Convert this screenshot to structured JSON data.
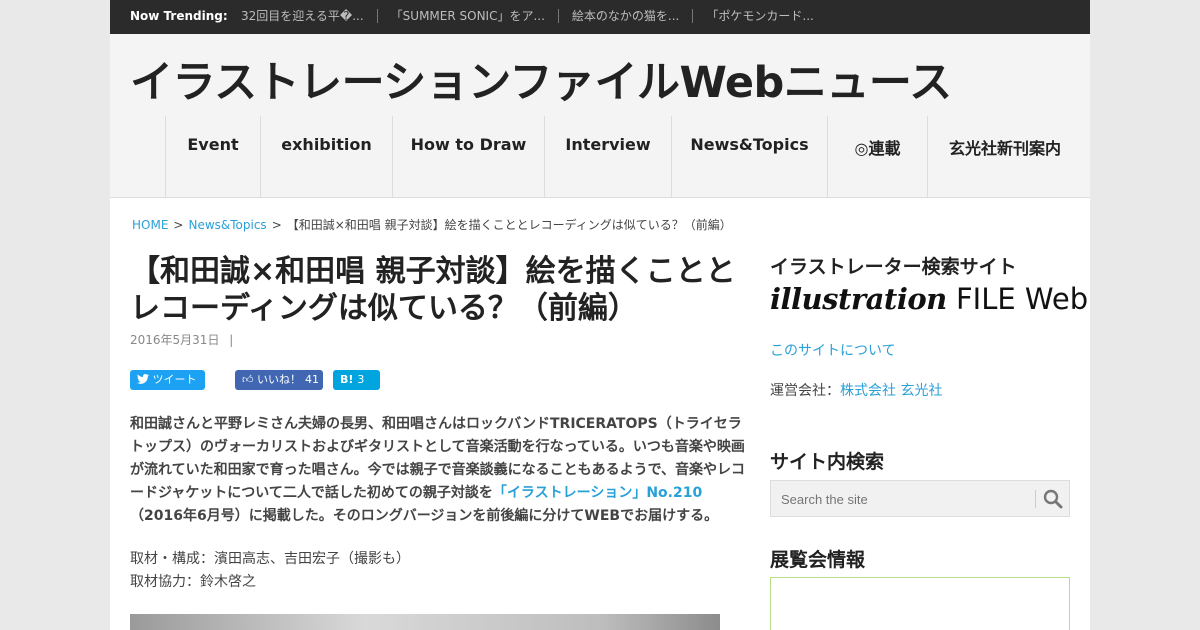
{
  "trending": {
    "label": "Now Trending:",
    "items": [
      "32回目を迎える平�...",
      "「SUMMER SONIC」をア...",
      "絵本のなかの猫を...",
      "「ポケモンカード..."
    ]
  },
  "site": {
    "title": "イラストレーションファイルWebニュース"
  },
  "nav": [
    "Event",
    "exhibition",
    "How to Draw",
    "Interview",
    "News&Topics",
    "◎連載",
    "玄光社新刊案内"
  ],
  "breadcrumb": {
    "home": "HOME",
    "sep": ">",
    "category": "News&Topics",
    "current": "【和田誠×和田唱 親子対談】絵を描くこととレコーディングは似ている？（前編）"
  },
  "post": {
    "title": "【和田誠×和田唱 親子対談】絵を描くこととレコーディングは似ている？（前編）",
    "date": "2016年5月31日",
    "meta_sep": "|",
    "share": {
      "tweet": "ツイート",
      "like": "いいね！",
      "like_count": "41",
      "hatena": "B!",
      "hatena_count": "3"
    },
    "lead_before": "和田誠さんと平野レミさん夫婦の長男、和田唱さんはロックバンドTRICERATOPS（トライセラトップス）のヴォーカリストおよびギタリストとして音楽活動を行なっている。いつも音楽や映画が流れていた和田家で育った唱さん。今では親子で音楽談義になることもあるようで、音楽やレコードジャケットについて二人で話した初めての親子対談を",
    "lead_link": "「イラストレーション」No.210",
    "lead_after": "（2016年6月号）に掲載した。そのロングバージョンを前後編に分けてWEBでお届けする。",
    "credit1": "取材・構成：濱田高志、吉田宏子（撮影も）",
    "credit2": "取材協力：鈴木啓之"
  },
  "sidebar": {
    "search_site_heading": "イラストレーター検索サイト",
    "logo_script": "illustration",
    "logo_text": "FILE Web",
    "about_link": "このサイトについて",
    "company_label": "運営会社：",
    "company_link": "株式会社 玄光社",
    "search_heading": "サイト内検索",
    "search_placeholder": "Search the site",
    "exhibition_heading": "展覧会情報"
  },
  "colors": {
    "accent": "#2aa0d8",
    "topbar": "#2b2b2b",
    "twitter": "#1da1f2",
    "facebook": "#4267b2",
    "hatena": "#00a4de"
  }
}
